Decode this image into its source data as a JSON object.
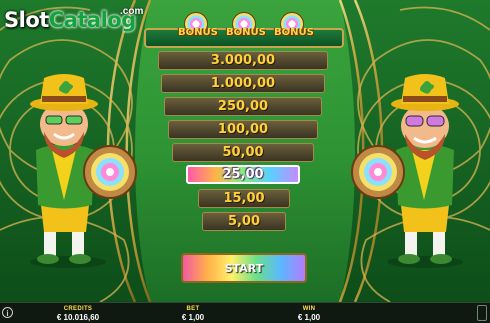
{
  "watermark": {
    "part1": "Slot",
    "part2": "Catalog",
    "suffix": ".com"
  },
  "bonus_header": {
    "labels": [
      "BONUS",
      "BONUS",
      "BONUS"
    ]
  },
  "prize_ladder": {
    "values": [
      "3.000,00",
      "1.000,00",
      "250,00",
      "100,00",
      "50,00",
      "25,00",
      "15,00",
      "5,00"
    ],
    "active_value": "25,00"
  },
  "start_button": {
    "label": "START"
  },
  "hud": {
    "credits_label": "CREDITS",
    "credits_value": "€ 10.016,60",
    "bet_label": "BET",
    "bet_value": "€ 1,00",
    "win_label": "WIN",
    "win_value": "€ 1,00"
  },
  "colors": {
    "ladder_text": "#ffd23c",
    "hud_label": "#ffe14a",
    "bonus_text": "#ffd84a"
  }
}
